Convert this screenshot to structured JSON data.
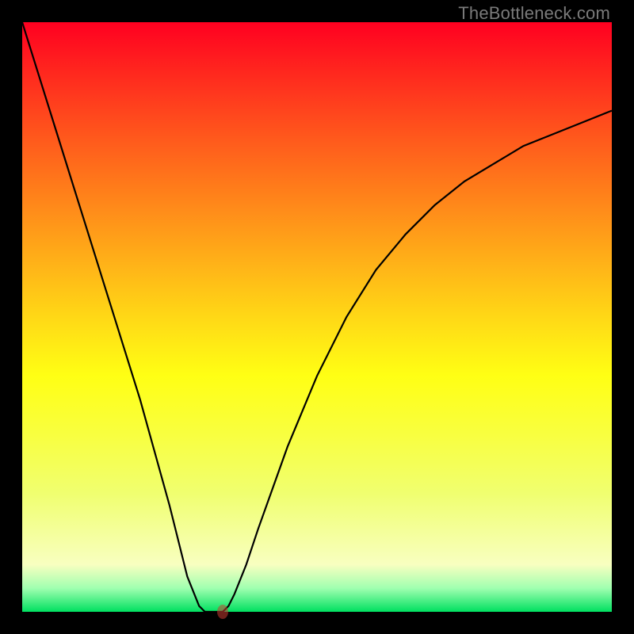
{
  "watermark": "TheBottleneck.com",
  "chart_data": {
    "type": "line",
    "title": "",
    "xlabel": "",
    "ylabel": "",
    "xlim": [
      0,
      100
    ],
    "ylim": [
      0,
      100
    ],
    "grid": false,
    "series": [
      {
        "name": "curve",
        "x": [
          0,
          5,
          10,
          15,
          20,
          25,
          28,
          30,
          31,
          32,
          33,
          34,
          35,
          36,
          38,
          40,
          45,
          50,
          55,
          60,
          65,
          70,
          75,
          80,
          85,
          90,
          95,
          100
        ],
        "y": [
          100,
          84,
          68,
          52,
          36,
          18,
          6,
          1,
          0,
          0,
          0,
          0,
          1,
          3,
          8,
          14,
          28,
          40,
          50,
          58,
          64,
          69,
          73,
          76,
          79,
          81,
          83,
          85
        ]
      }
    ],
    "flat_bottom": {
      "x_start": 30,
      "x_end": 34,
      "y": 0
    },
    "marker": {
      "x": 34,
      "y": 0,
      "color": "#c8483a"
    },
    "background_gradient": {
      "top": "#ff0020",
      "bottom": "#00e060",
      "stops": [
        "red",
        "orange",
        "yellow",
        "pale-yellow",
        "green"
      ]
    },
    "border_color": "#000000"
  }
}
